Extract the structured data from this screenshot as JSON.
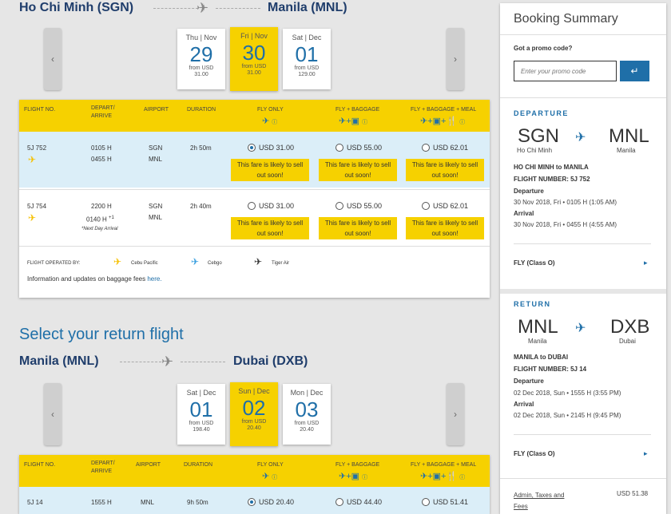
{
  "outbound": {
    "from": "Ho Chi Minh (SGN)",
    "to": "Manila (MNL)",
    "dates": [
      {
        "day": "Thu | Nov",
        "date": "29",
        "from_label": "from USD",
        "price": "31.00",
        "selected": false
      },
      {
        "day": "Fri | Nov",
        "date": "30",
        "from_label": "from USD",
        "price": "31.00",
        "selected": true
      },
      {
        "day": "Sat | Dec",
        "date": "01",
        "from_label": "from USD",
        "price": "129.00",
        "selected": false
      }
    ],
    "headers": {
      "flight_no": "FLIGHT NO.",
      "depart_arrive": "DEPART/ ARRIVE",
      "airport": "AIRPORT",
      "duration": "DURATION",
      "fly_only": "FLY ONLY",
      "fly_baggage": "FLY + BAGGAGE",
      "fly_baggage_meal": "FLY + BAGGAGE + MEAL"
    },
    "flights": [
      {
        "no": "5J 752",
        "depart": "0105 H",
        "arrive": "0455 H",
        "arrive_sup": "",
        "note": "",
        "from_ap": "SGN",
        "to_ap": "MNL",
        "duration": "2h 50m",
        "fares": [
          "USD 31.00",
          "USD 55.00",
          "USD 62.01"
        ],
        "selected": 0,
        "warning": "This fare is likely to sell out soon!"
      },
      {
        "no": "5J 754",
        "depart": "2200 H",
        "arrive": "0140 H",
        "arrive_sup": "+1",
        "note": "*Next Day Arrival",
        "from_ap": "SGN",
        "to_ap": "MNL",
        "duration": "2h 40m",
        "fares": [
          "USD 31.00",
          "USD 55.00",
          "USD 62.01"
        ],
        "selected": -1,
        "warning": "This fare is likely to sell out soon!"
      }
    ],
    "operated_by_label": "FLIGHT OPERATED BY:",
    "operators": [
      "Cebu Pacific",
      "Cebgo",
      "Tiger Air"
    ],
    "info_text": "Information and updates on baggage fees ",
    "info_link": "here."
  },
  "return_heading": "Select your return flight",
  "inbound": {
    "from": "Manila (MNL)",
    "to": "Dubai (DXB)",
    "dates": [
      {
        "day": "Sat | Dec",
        "date": "01",
        "from_label": "from USD",
        "price": "198.40",
        "selected": false
      },
      {
        "day": "Sun | Dec",
        "date": "02",
        "from_label": "from USD",
        "price": "20.40",
        "selected": true
      },
      {
        "day": "Mon | Dec",
        "date": "03",
        "from_label": "from USD",
        "price": "20.40",
        "selected": false
      }
    ],
    "flight": {
      "no": "5J 14",
      "depart": "1555 H",
      "from_ap": "MNL",
      "duration": "9h 50m",
      "fares": [
        "USD 20.40",
        "USD 44.40",
        "USD 51.41"
      ]
    }
  },
  "summary": {
    "title": "Booking Summary",
    "promo_label": "Got a promo code?",
    "promo_placeholder": "Enter your promo code",
    "departure": {
      "section": "DEPARTURE",
      "from_code": "SGN",
      "from_city": "Ho Chi Minh",
      "to_code": "MNL",
      "to_city": "Manila",
      "route": "HO CHI MINH to MANILA",
      "flight_number": "FLIGHT NUMBER: 5J 752",
      "dep_label": "Departure",
      "dep_value": "30 Nov 2018, Fri • 0105 H (1:05 AM)",
      "arr_label": "Arrival",
      "arr_value": "30 Nov 2018, Fri • 0455 H (4:55 AM)",
      "fly_class": "FLY (Class O)"
    },
    "return": {
      "section": "RETURN",
      "from_code": "MNL",
      "from_city": "Manila",
      "to_code": "DXB",
      "to_city": "Dubai",
      "route": "MANILA to DUBAI",
      "flight_number": "FLIGHT NUMBER: 5J 14",
      "dep_label": "Departure",
      "dep_value": "02 Dec 2018, Sun • 1555 H (3:55 PM)",
      "arr_label": "Arrival",
      "arr_value": "02 Dec 2018, Sun • 2145 H (9:45 PM)",
      "fly_class": "FLY (Class O)"
    },
    "admin_label": "Admin, Taxes and Fees",
    "admin_value": "USD 51.38"
  },
  "colors": {
    "accent": "#f6d100",
    "brand_blue": "#1f6fa8",
    "navy": "#1f3d6b"
  }
}
